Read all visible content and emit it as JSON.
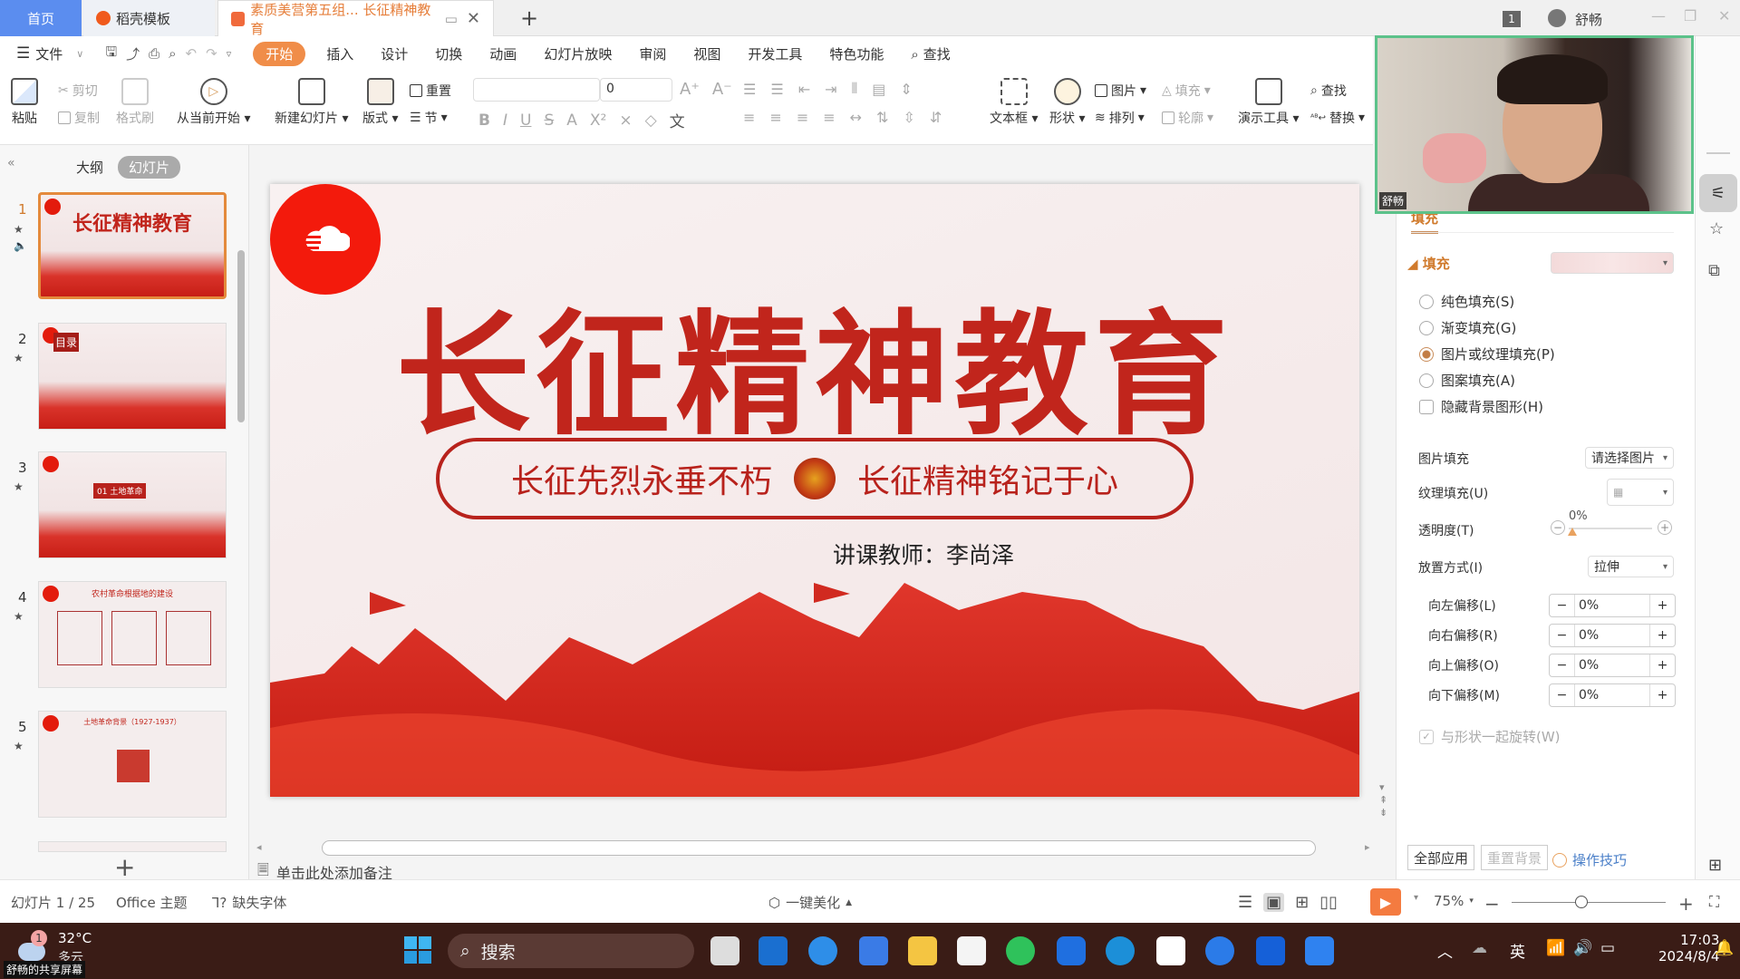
{
  "tabs": {
    "home": "首页",
    "template": "稻壳模板",
    "document": "素质美营第五组... 长征精神教育",
    "new_tab": "+"
  },
  "window": {
    "badge": "1",
    "user": "舒畅"
  },
  "menu": {
    "file": "文件",
    "items": [
      "开始",
      "插入",
      "设计",
      "切换",
      "动画",
      "幻灯片放映",
      "审阅",
      "视图",
      "开发工具",
      "特色功能"
    ],
    "active": "开始",
    "search": "查找"
  },
  "ribbon": {
    "paste": "粘贴",
    "cut": "剪切",
    "copy": "复制",
    "format_painter": "格式刷",
    "play_from_current": "从当前开始",
    "new_slide": "新建幻灯片",
    "layout": "版式",
    "reset": "重置",
    "section": "节",
    "font_name": "",
    "font_size": "0",
    "textbox": "文本框",
    "shape": "形状",
    "picture": "图片",
    "arrange": "排列",
    "fill": "填充",
    "outline": "轮廓",
    "presentation_tools": "演示工具",
    "find": "查找",
    "replace": "替换"
  },
  "left_panel": {
    "outline_tab": "大纲",
    "slides_tab": "幻灯片",
    "slides": [
      {
        "num": "1",
        "title": "长征精神教育",
        "selected": true
      },
      {
        "num": "2",
        "title": "目录"
      },
      {
        "num": "3",
        "title": "01 土地革命"
      },
      {
        "num": "4",
        "title": "农村革命根据地的建设"
      },
      {
        "num": "5",
        "title": "土地革命背景（1927-1937）"
      }
    ],
    "add_slide": "+"
  },
  "slide": {
    "title": "长征精神教育",
    "banner_left": "长征先烈永垂不朽",
    "banner_right": "长征精神铭记于心",
    "teacher": "讲课教师：李尚泽"
  },
  "notes_placeholder": "单击此处添加备注",
  "video": {
    "name": "舒畅"
  },
  "right_panel": {
    "tab": "填充",
    "section": "填充",
    "options": [
      {
        "label": "纯色填充(S)",
        "checked": false
      },
      {
        "label": "渐变填充(G)",
        "checked": false
      },
      {
        "label": "图片或纹理填充(P)",
        "checked": true
      },
      {
        "label": "图案填充(A)",
        "checked": false
      }
    ],
    "hide_bg": "隐藏背景图形(H)",
    "picture_fill_label": "图片填充",
    "picture_fill_value": "请选择图片",
    "texture_fill_label": "纹理填充(U)",
    "transparency_label": "透明度(T)",
    "transparency_value": "0%",
    "placement_label": "放置方式(I)",
    "placement_value": "拉伸",
    "offsets": [
      {
        "label": "向左偏移(L)",
        "value": "0%"
      },
      {
        "label": "向右偏移(R)",
        "value": "0%"
      },
      {
        "label": "向上偏移(O)",
        "value": "0%"
      },
      {
        "label": "向下偏移(M)",
        "value": "0%"
      }
    ],
    "rotate_with_shape": "与形状一起旋转(W)",
    "apply_all": "全部应用",
    "reset_bg": "重置背景",
    "tips": "操作技巧"
  },
  "status": {
    "slide_counter": "幻灯片 1 / 25",
    "theme": "Office 主题",
    "missing_fonts": "缺失字体",
    "beautify": "一键美化",
    "zoom": "75%",
    "zoom_fraction": 0.45
  },
  "taskbar": {
    "weather_temp": "32°C",
    "weather_desc": "多云",
    "weather_badge": "1",
    "share_label": "舒畅的共享屏幕",
    "search": "搜索",
    "ime": "英",
    "time": "17:03",
    "date": "2024/8/4"
  },
  "colors": {
    "accent": "#f08d49",
    "slide_red": "#c1251c",
    "home_tab": "#5b8def",
    "video_border": "#5cc28a"
  }
}
